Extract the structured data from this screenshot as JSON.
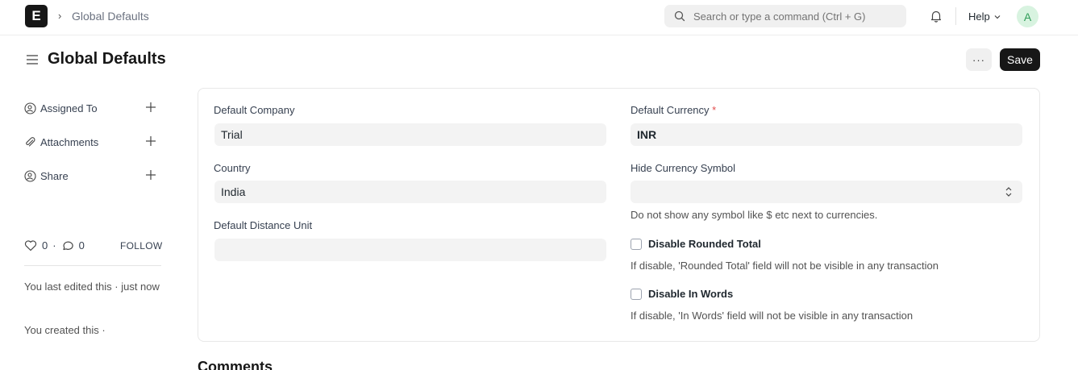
{
  "navbar": {
    "logo_letter": "E",
    "breadcrumb_sep": "›",
    "breadcrumb": "Global Defaults",
    "search_placeholder": "Search or type a command (Ctrl + G)",
    "help_label": "Help",
    "avatar_letter": "A"
  },
  "page": {
    "title": "Global Defaults",
    "more_label": "···",
    "save_label": "Save"
  },
  "sidebar": {
    "items": [
      {
        "label": "Assigned To",
        "icon": "user-plus-icon"
      },
      {
        "label": "Attachments",
        "icon": "paperclip-icon"
      },
      {
        "label": "Share",
        "icon": "share-user-icon"
      }
    ],
    "like_count": "0",
    "dot": "·",
    "comment_count": "0",
    "follow_label": "FOLLOW",
    "last_edited": "You last edited this · just now",
    "created": "You created this ·"
  },
  "form": {
    "default_company": {
      "label": "Default Company",
      "value": "Trial"
    },
    "country": {
      "label": "Country",
      "value": "India"
    },
    "default_distance_unit": {
      "label": "Default Distance Unit",
      "value": ""
    },
    "default_currency": {
      "label": "Default Currency",
      "required_mark": "*",
      "value": "INR"
    },
    "hide_currency_symbol": {
      "label": "Hide Currency Symbol",
      "value": "",
      "description": "Do not show any symbol like $ etc next to currencies."
    },
    "disable_rounded_total": {
      "label": "Disable Rounded Total",
      "checked": false,
      "description": "If disable, 'Rounded Total' field will not be visible in any transaction"
    },
    "disable_in_words": {
      "label": "Disable In Words",
      "checked": false,
      "description": "If disable, 'In Words' field will not be visible in any transaction"
    }
  },
  "comments_heading": "Comments",
  "colors": {
    "primary": "#171717",
    "avatar_bg": "#d8f3e0",
    "avatar_fg": "#2f9d58",
    "required": "#e24c4c"
  }
}
